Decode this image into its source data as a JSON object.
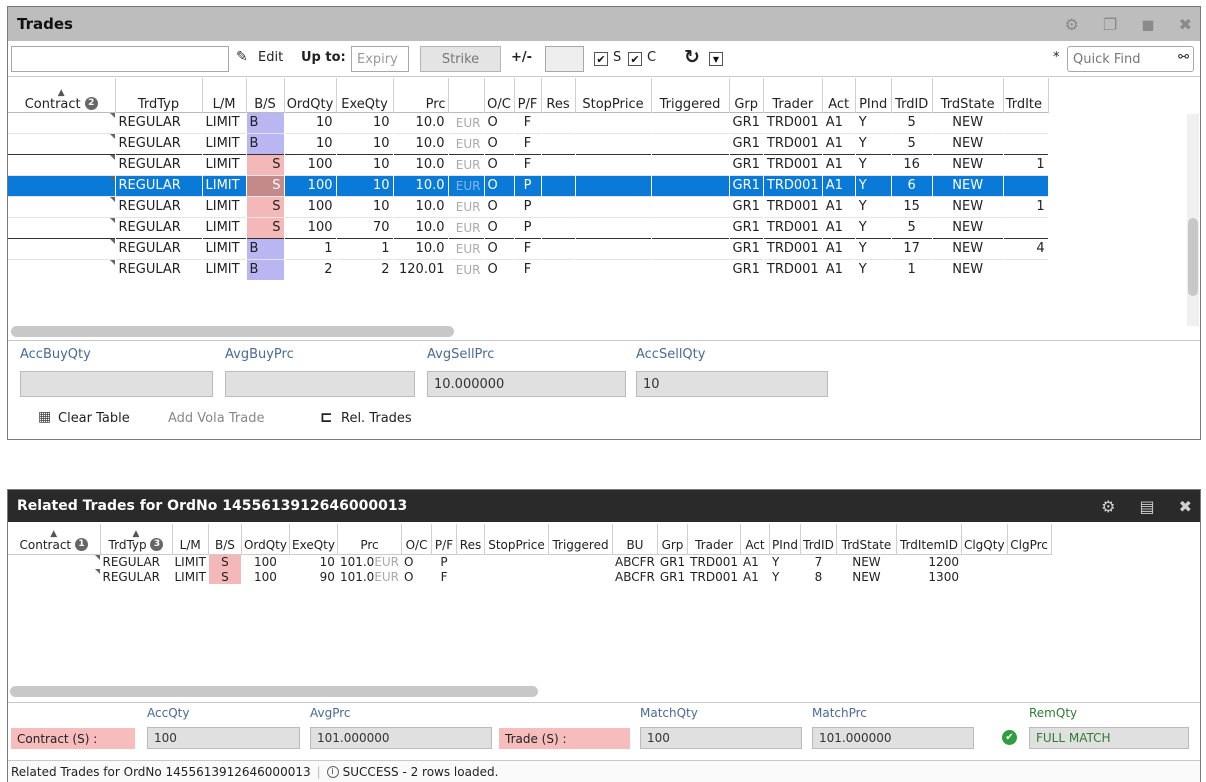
{
  "trades_panel": {
    "title": "Trades",
    "toolbar": {
      "edit_label": "Edit",
      "upto_label": "Up to:",
      "expiry_placeholder": "Expiry",
      "strike_label": "Strike",
      "plusminus_label": "+/-",
      "s_label": "S",
      "c_label": "C",
      "s_checked": "✔",
      "c_checked": "✔",
      "asterisk": "*",
      "quick_find_placeholder": "Quick Find"
    },
    "columns": [
      "Contract",
      "TrdTyp",
      "L/M",
      "B/S",
      "OrdQty",
      "ExeQty",
      "Prc",
      "",
      "O/C",
      "P/F",
      "Res",
      "StopPrice",
      "Triggered",
      "Grp",
      "Trader",
      "Act",
      "PInd",
      "TrdID",
      "TrdState",
      "TrdIte"
    ],
    "contract_badge": "2",
    "rows": [
      {
        "trdtyp": "REGULAR",
        "lm": "LIMIT",
        "bs": "B",
        "ordqty": "10",
        "exeqty": "10",
        "prc": "10.0",
        "cur": "EUR",
        "oc": "O",
        "pf": "F",
        "grp": "GR1",
        "trader": "TRD001",
        "act": "A1",
        "pind": "Y",
        "trdid": "5",
        "trdstate": "NEW",
        "trdite": ""
      },
      {
        "trdtyp": "REGULAR",
        "lm": "LIMIT",
        "bs": "B",
        "ordqty": "10",
        "exeqty": "10",
        "prc": "10.0",
        "cur": "EUR",
        "oc": "O",
        "pf": "F",
        "grp": "GR1",
        "trader": "TRD001",
        "act": "A1",
        "pind": "Y",
        "trdid": "5",
        "trdstate": "NEW",
        "trdite": ""
      },
      {
        "trdtyp": "REGULAR",
        "lm": "LIMIT",
        "bs": "S",
        "ordqty": "100",
        "exeqty": "10",
        "prc": "10.0",
        "cur": "EUR",
        "oc": "O",
        "pf": "F",
        "grp": "GR1",
        "trader": "TRD001",
        "act": "A1",
        "pind": "Y",
        "trdid": "16",
        "trdstate": "NEW",
        "trdite": "1"
      },
      {
        "trdtyp": "REGULAR",
        "lm": "LIMIT",
        "bs": "S",
        "ordqty": "100",
        "exeqty": "10",
        "prc": "10.0",
        "cur": "EUR",
        "oc": "O",
        "pf": "P",
        "grp": "GR1",
        "trader": "TRD001",
        "act": "A1",
        "pind": "Y",
        "trdid": "6",
        "trdstate": "NEW",
        "trdite": ""
      },
      {
        "trdtyp": "REGULAR",
        "lm": "LIMIT",
        "bs": "S",
        "ordqty": "100",
        "exeqty": "10",
        "prc": "10.0",
        "cur": "EUR",
        "oc": "O",
        "pf": "P",
        "grp": "GR1",
        "trader": "TRD001",
        "act": "A1",
        "pind": "Y",
        "trdid": "15",
        "trdstate": "NEW",
        "trdite": "1"
      },
      {
        "trdtyp": "REGULAR",
        "lm": "LIMIT",
        "bs": "S",
        "ordqty": "100",
        "exeqty": "70",
        "prc": "10.0",
        "cur": "EUR",
        "oc": "O",
        "pf": "P",
        "grp": "GR1",
        "trader": "TRD001",
        "act": "A1",
        "pind": "Y",
        "trdid": "5",
        "trdstate": "NEW",
        "trdite": ""
      },
      {
        "trdtyp": "REGULAR",
        "lm": "LIMIT",
        "bs": "B",
        "ordqty": "1",
        "exeqty": "1",
        "prc": "10.0",
        "cur": "EUR",
        "oc": "O",
        "pf": "F",
        "grp": "GR1",
        "trader": "TRD001",
        "act": "A1",
        "pind": "Y",
        "trdid": "17",
        "trdstate": "NEW",
        "trdite": "4"
      },
      {
        "trdtyp": "REGULAR",
        "lm": "LIMIT",
        "bs": "B",
        "ordqty": "2",
        "exeqty": "2",
        "prc": "120.01",
        "cur": "EUR",
        "oc": "O",
        "pf": "F",
        "grp": "GR1",
        "trader": "TRD001",
        "act": "A1",
        "pind": "Y",
        "trdid": "1",
        "trdstate": "NEW",
        "trdite": ""
      }
    ],
    "summary": {
      "acc_buy_qty_label": "AccBuyQty",
      "acc_buy_qty": "",
      "avg_buy_prc_label": "AvgBuyPrc",
      "avg_buy_prc": "",
      "avg_sell_prc_label": "AvgSellPrc",
      "avg_sell_prc": "10.000000",
      "acc_sell_qty_label": "AccSellQty",
      "acc_sell_qty": "10"
    },
    "actions": {
      "clear_table": "Clear Table",
      "add_vola_trade": "Add Vola Trade",
      "rel_trades": "Rel. Trades"
    }
  },
  "related_panel": {
    "title": "Related Trades for OrdNo 1455613912646000013",
    "columns": [
      "Contract",
      "TrdTyp",
      "L/M",
      "B/S",
      "OrdQty",
      "ExeQty",
      "Prc",
      "O/C",
      "P/F",
      "Res",
      "StopPrice",
      "Triggered",
      "BU",
      "Grp",
      "Trader",
      "Act",
      "PInd",
      "TrdID",
      "TrdState",
      "TrdItemID",
      "ClgQty",
      "ClgPrc"
    ],
    "contract_badge": "1",
    "trdtyp_badge": "3",
    "rows": [
      {
        "trdtyp": "REGULAR",
        "lm": "LIMIT",
        "bs": "S",
        "ordqty": "100",
        "exeqty": "10",
        "prc": "101.0",
        "cur": "EUR",
        "oc": "O",
        "pf": "P",
        "bu": "ABCFR",
        "grp": "GR1",
        "trader": "TRD001",
        "act": "A1",
        "pind": "Y",
        "trdid": "7",
        "trdstate": "NEW",
        "trditemid": "1200"
      },
      {
        "trdtyp": "REGULAR",
        "lm": "LIMIT",
        "bs": "S",
        "ordqty": "100",
        "exeqty": "90",
        "prc": "101.0",
        "cur": "EUR",
        "oc": "O",
        "pf": "F",
        "bu": "ABCFR",
        "grp": "GR1",
        "trader": "TRD001",
        "act": "A1",
        "pind": "Y",
        "trdid": "8",
        "trdstate": "NEW",
        "trditemid": "1300"
      }
    ],
    "summary": {
      "contract_label": "Contract (S) :",
      "acc_qty_label": "AccQty",
      "acc_qty": "100",
      "avg_prc_label": "AvgPrc",
      "avg_prc": "101.000000",
      "trade_label": "Trade (S) :",
      "match_qty_label": "MatchQty",
      "match_qty": "100",
      "match_prc_label": "MatchPrc",
      "match_prc": "101.000000",
      "rem_qty_label": "RemQty",
      "rem_qty": "FULL MATCH"
    },
    "status": {
      "source": "Related Trades for OrdNo 1455613912646000013",
      "message": "SUCCESS - 2 rows loaded."
    }
  },
  "colors": {
    "buy": "#b9b6f2",
    "sell": "#f4b8b8",
    "selected": "#0a7ad8",
    "success": "#2e9e3e"
  }
}
